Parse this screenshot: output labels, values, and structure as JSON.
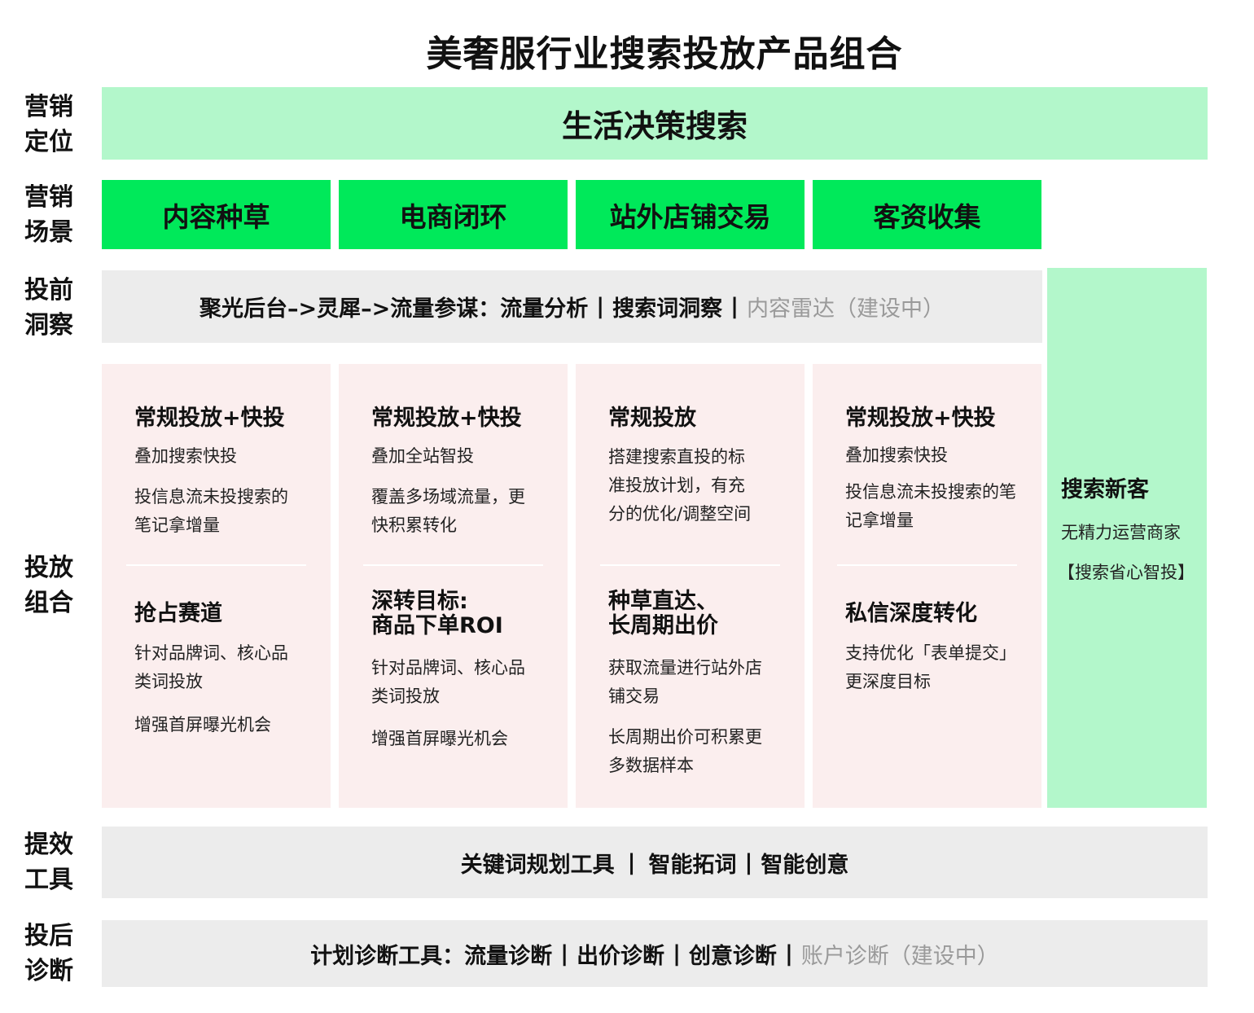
{
  "title": "美奢服行业搜索投放产品组合",
  "row_labels": {
    "positioning": [
      "营销",
      "定位"
    ],
    "scene": [
      "营销",
      "场景"
    ],
    "insight": [
      "投前",
      "洞察"
    ],
    "combo": [
      "投放",
      "组合"
    ],
    "tools": [
      "提效",
      "工具"
    ],
    "diagnosis": [
      "投后",
      "诊断"
    ]
  },
  "positioning": "生活决策搜索",
  "scenes": [
    "内容种草",
    "电商闭环",
    "站外店铺交易",
    "客资收集"
  ],
  "insight": {
    "main": "聚光后台–>灵犀–>流量参谋：流量分析",
    "sep1": "|",
    "item2": "搜索词洞察",
    "sep2": "|",
    "muted": "内容雷达（建设中）"
  },
  "cards": [
    {
      "h1": "常规投放+快投",
      "p1": [
        "叠加搜索快投"
      ],
      "p2": [
        "投信息流未投搜索的",
        "笔记拿增量"
      ],
      "h2": [
        "抢占赛道"
      ],
      "p3": [
        "针对品牌词、核心品",
        "类词投放"
      ],
      "p4": [
        "增强首屏曝光机会"
      ]
    },
    {
      "h1": "常规投放+快投",
      "p1": [
        "叠加全站智投"
      ],
      "p2": [
        "覆盖多场域流量，更",
        "快积累转化"
      ],
      "h2": [
        "深转目标:",
        "商品下单ROI"
      ],
      "p3": [
        "针对品牌词、核心品",
        "类词投放"
      ],
      "p4": [
        "增强首屏曝光机会"
      ]
    },
    {
      "h1": "常规投放",
      "p1": [
        "搭建搜索直投的标",
        "准投放计划，有充",
        "分的优化/调整空间"
      ],
      "p2": [],
      "h2": [
        "种草直达、",
        "长周期出价"
      ],
      "p3": [
        "获取流量进行站外店",
        "铺交易"
      ],
      "p4": [
        "长周期出价可积累更",
        "多数据样本"
      ]
    },
    {
      "h1": "常规投放+快投",
      "p1": [
        "叠加搜索快投"
      ],
      "p2": [
        "投信息流未投搜索的笔",
        "记拿增量"
      ],
      "h2": [
        "私信深度转化"
      ],
      "p3": [
        "支持优化「表单提交」",
        "更深度目标"
      ],
      "p4": []
    }
  ],
  "side": {
    "title": "搜索新客",
    "line1": "无精力运营商家",
    "line2": "【搜索省心智投】"
  },
  "tools": {
    "a": "关键词规划工具",
    "sep1": "|",
    "b": "智能拓词",
    "sep2": "|",
    "c": "智能创意"
  },
  "diagnosis": {
    "main": "计划诊断工具：流量诊断",
    "sep1": "|",
    "b": "出价诊断",
    "sep2": "|",
    "c": "创意诊断",
    "sep3": "|",
    "muted": "账户诊断（建设中）"
  },
  "colors": {
    "light_green": "#b3f7cb",
    "green": "#00e95a",
    "grey": "#ececec",
    "pink": "#fbeeee",
    "muted": "#9a9a9a"
  }
}
